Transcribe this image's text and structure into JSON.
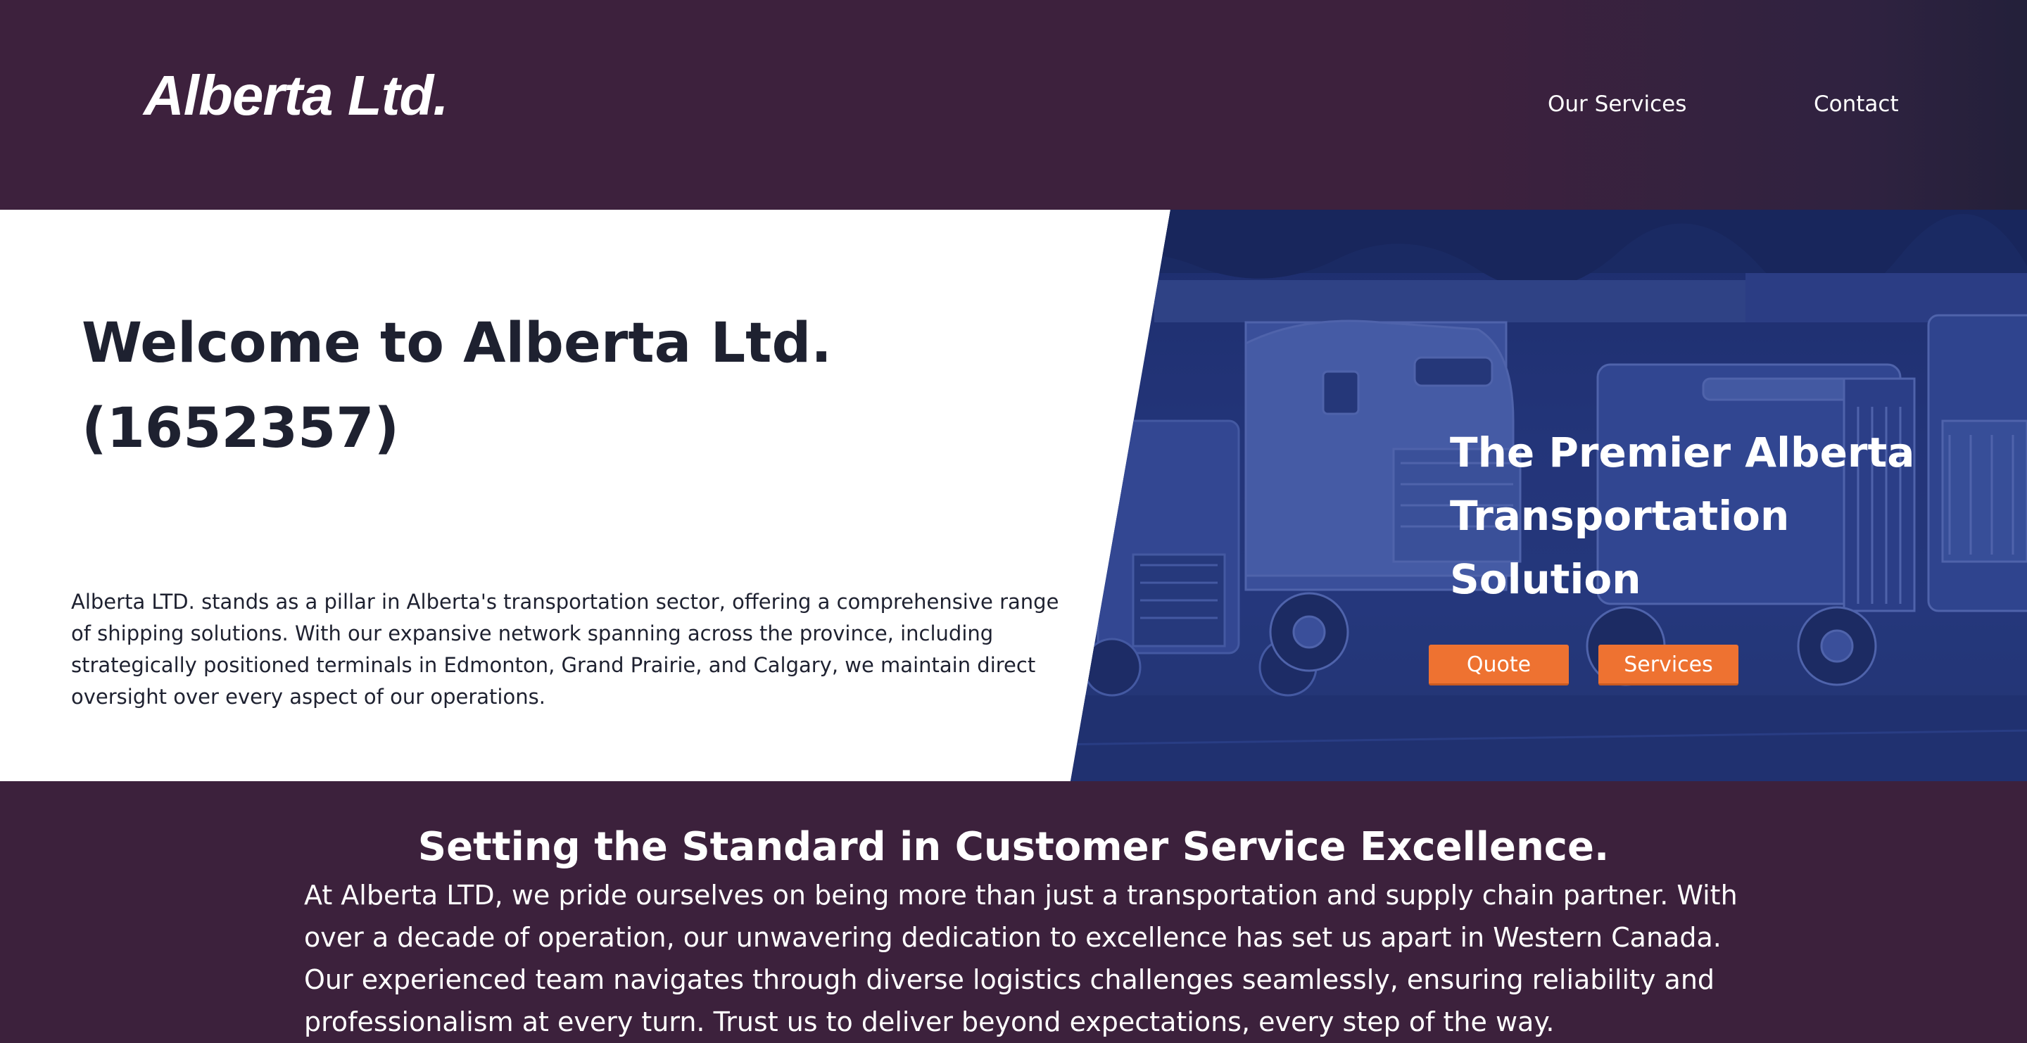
{
  "header": {
    "brand": "Alberta Ltd.",
    "nav": [
      {
        "label": "Our Services"
      },
      {
        "label": "Contact"
      }
    ]
  },
  "hero": {
    "title_line1": "Welcome to Alberta Ltd.",
    "title_line2": "(1652357)",
    "paragraph": "Alberta LTD. stands as a pillar in Alberta's transportation sector, offering a comprehensive range of shipping solutions. With our expansive network spanning across the province, including strategically positioned terminals in Edmonton, Grand Prairie, and Calgary, we maintain direct oversight over every aspect of our operations.",
    "tagline": "The Premier Alberta Transportation Solution",
    "buttons": {
      "quote": "Quote",
      "services": "Services"
    },
    "image_subject": "semi-trucks-photo"
  },
  "excellence": {
    "heading": "Setting the Standard in Customer Service Excellence.",
    "body": "At Alberta LTD, we pride ourselves on being more than just a transportation and supply chain partner. With over a decade of operation, our unwavering dedication to excellence has set us apart in Western Canada. Our experienced team navigates through diverse logistics challenges seamlessly, ensuring reliability and professionalism at every turn. Trust us to deliver beyond expectations, every step of the way."
  },
  "colors": {
    "header_bg": "#3d213d",
    "hero_overlay": "#27397a",
    "accent": "#ee7231",
    "text_dark": "#1e2130",
    "text_light": "#ffffff"
  }
}
